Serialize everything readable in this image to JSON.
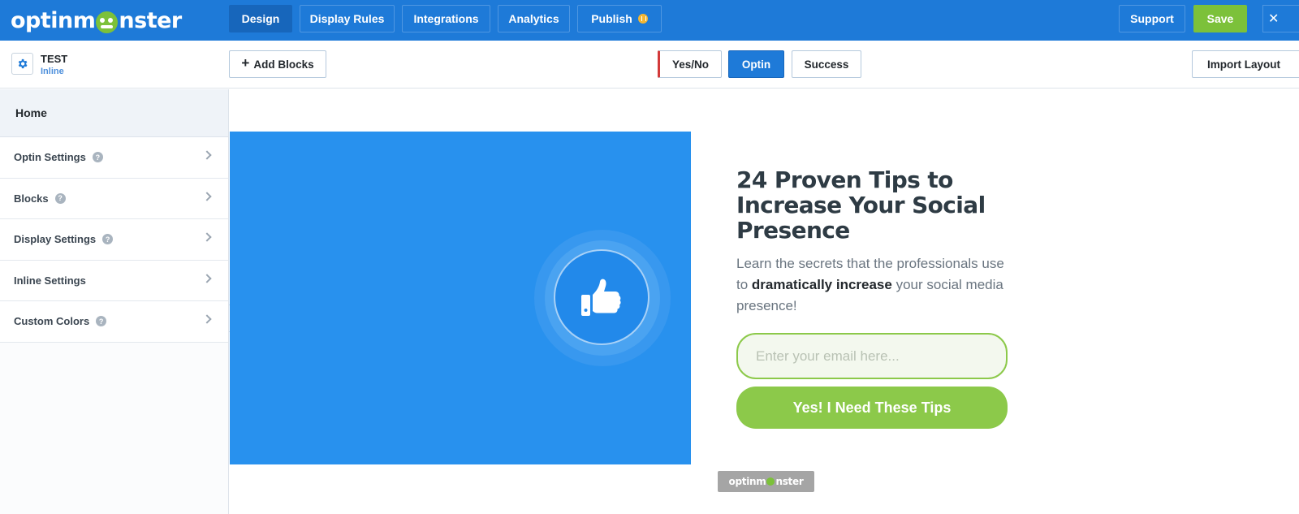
{
  "brand": {
    "logo_pre": "optinm",
    "logo_post": "nster"
  },
  "topnav": {
    "tabs": [
      {
        "label": "Design",
        "active": true
      },
      {
        "label": "Display Rules",
        "active": false
      },
      {
        "label": "Integrations",
        "active": false
      },
      {
        "label": "Analytics",
        "active": false
      },
      {
        "label": "Publish",
        "active": false
      }
    ],
    "support_label": "Support",
    "save_label": "Save",
    "close_label": "✕"
  },
  "campaign": {
    "name": "TEST",
    "type": "Inline"
  },
  "toolbar": {
    "add_blocks_label": "Add Blocks",
    "views": [
      {
        "label": "Yes/No",
        "active": false
      },
      {
        "label": "Optin",
        "active": true
      },
      {
        "label": "Success",
        "active": false
      }
    ],
    "import_label": "Import Layout"
  },
  "sidebar": {
    "home_label": "Home",
    "items": [
      {
        "label": "Optin Settings",
        "help": true
      },
      {
        "label": "Blocks",
        "help": true
      },
      {
        "label": "Display Settings",
        "help": true
      },
      {
        "label": "Inline Settings",
        "help": false
      },
      {
        "label": "Custom Colors",
        "help": true
      }
    ]
  },
  "optin": {
    "headline": "24 Proven Tips to Increase Your Social Presence",
    "sub_pre": "Learn the secrets that the professionals use to ",
    "sub_bold": "dramatically increase",
    "sub_post": " your social media presence!",
    "email_placeholder": "Enter your email here...",
    "cta_label": "Yes! I Need These Tips",
    "powered_pre": "optinm",
    "powered_post": "nster"
  },
  "colors": {
    "nav_blue": "#1e7ad8",
    "hero_blue": "#2891ee",
    "green": "#8cc94a",
    "publish_dot": "#f3b632",
    "yesno_accent": "#d33a3a"
  },
  "icons": [
    "gear-icon",
    "plus-icon",
    "help-icon",
    "chevron-right-icon",
    "chevron-left-icon",
    "thumbs-up-icon",
    "close-icon"
  ]
}
